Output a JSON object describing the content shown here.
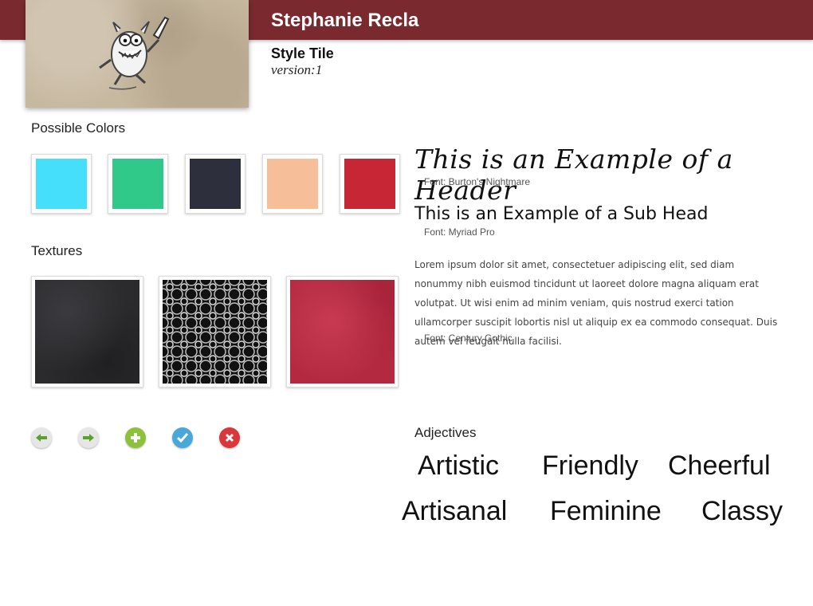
{
  "header": {
    "name": "Stephanie Recla",
    "style_tile_label": "Style Tile",
    "version_label": "version:1"
  },
  "sections": {
    "colors_heading": "Possible Colors",
    "textures_heading": "Textures",
    "adjectives_heading": "Adjectives"
  },
  "colors": [
    {
      "hex": "#45DFFB"
    },
    {
      "hex": "#31C98A"
    },
    {
      "hex": "#2D2F3C"
    },
    {
      "hex": "#F6BF9A"
    },
    {
      "hex": "#C72635"
    }
  ],
  "textures": [
    {
      "name": "leather"
    },
    {
      "name": "swirl"
    },
    {
      "name": "red-fabric"
    }
  ],
  "icons": [
    {
      "name": "back-arrow-icon"
    },
    {
      "name": "forward-arrow-icon"
    },
    {
      "name": "plus-icon"
    },
    {
      "name": "check-icon"
    },
    {
      "name": "close-icon"
    }
  ],
  "typography": {
    "header_example": "This is an Example of a Header",
    "header_font": "Font: Burton's Nightmare",
    "subhead_example": "This is an Example of a Sub Head",
    "subhead_font": "Font: Myriad Pro",
    "body_text": "Lorem ipsum dolor sit amet, consectetuer adipiscing elit, sed diam nonummy nibh euismod tincidunt ut laoreet dolore magna aliquam erat volutpat. Ut wisi enim ad minim veniam, quis nostrud exerci tation ullamcorper suscipit lobortis nisl ut aliquip ex ea commodo consequat. Duis autem vel feugait nulla facilisi.",
    "body_font": "Font: Century Gothic"
  },
  "adjectives": [
    "Artistic",
    "Friendly",
    "Cheerful",
    "Artisanal",
    "Feminine",
    "Classy"
  ]
}
